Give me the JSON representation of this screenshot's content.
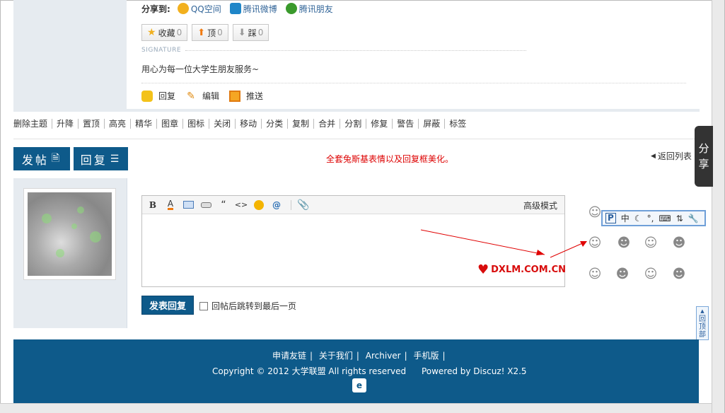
{
  "share": {
    "label": "分享到:",
    "items": [
      {
        "label": "QQ空间",
        "color": "#f2b01e"
      },
      {
        "label": "腾讯微博",
        "color": "#1f86c8"
      },
      {
        "label": "腾讯朋友",
        "color": "#3a9a2c"
      }
    ]
  },
  "votes": [
    {
      "label": "收藏",
      "count": "0",
      "icon": "star-icon"
    },
    {
      "label": "顶",
      "count": "0",
      "icon": "arrow-up-icon"
    },
    {
      "label": "踩",
      "count": "0",
      "icon": "arrow-down-icon"
    }
  ],
  "signature": {
    "label": "SIGNATURE",
    "text": "用心为每一位大学生朋友服务~"
  },
  "actions": [
    {
      "label": "回复",
      "icon": "reply-icon"
    },
    {
      "label": "编辑",
      "icon": "edit-icon"
    },
    {
      "label": "推送",
      "icon": "push-icon"
    }
  ],
  "moderation": [
    "删除主题",
    "升降",
    "置顶",
    "高亮",
    "精华",
    "图章",
    "图标",
    "关闭",
    "移动",
    "分类",
    "复制",
    "合并",
    "分割",
    "修复",
    "警告",
    "屏蔽",
    "标签"
  ],
  "buttons": {
    "post": "发帖",
    "reply": "回复"
  },
  "notice": "全套兔斯基表情以及回复框美化。",
  "back_to_list": "返回列表",
  "share_float": [
    "分",
    "享"
  ],
  "editor": {
    "tools": [
      "B",
      "A",
      "image",
      "link",
      "“",
      "<>",
      "emoji",
      "@",
      "attach"
    ],
    "advanced_mode": "高级模式",
    "watermark": "DXLM.COM.CN"
  },
  "submit": "发表回复",
  "checkbox_label": "回帖后跳转到最后一页",
  "ime": [
    "P",
    "中",
    "moon",
    "°,",
    "keyboard",
    "arrows",
    "wrench"
  ],
  "footer": {
    "links": [
      "申请友链",
      "关于我们",
      "Archiver",
      "手机版"
    ],
    "copyright": "Copyright © 2012 大学联盟  All rights reserved",
    "powered": "Powered by Discuz! X2.5"
  },
  "back_top": [
    "回",
    "顶",
    "部"
  ],
  "colors": {
    "brand": "#0e5a8a",
    "notice": "#dd0000",
    "watermark": "#d80c0c"
  }
}
